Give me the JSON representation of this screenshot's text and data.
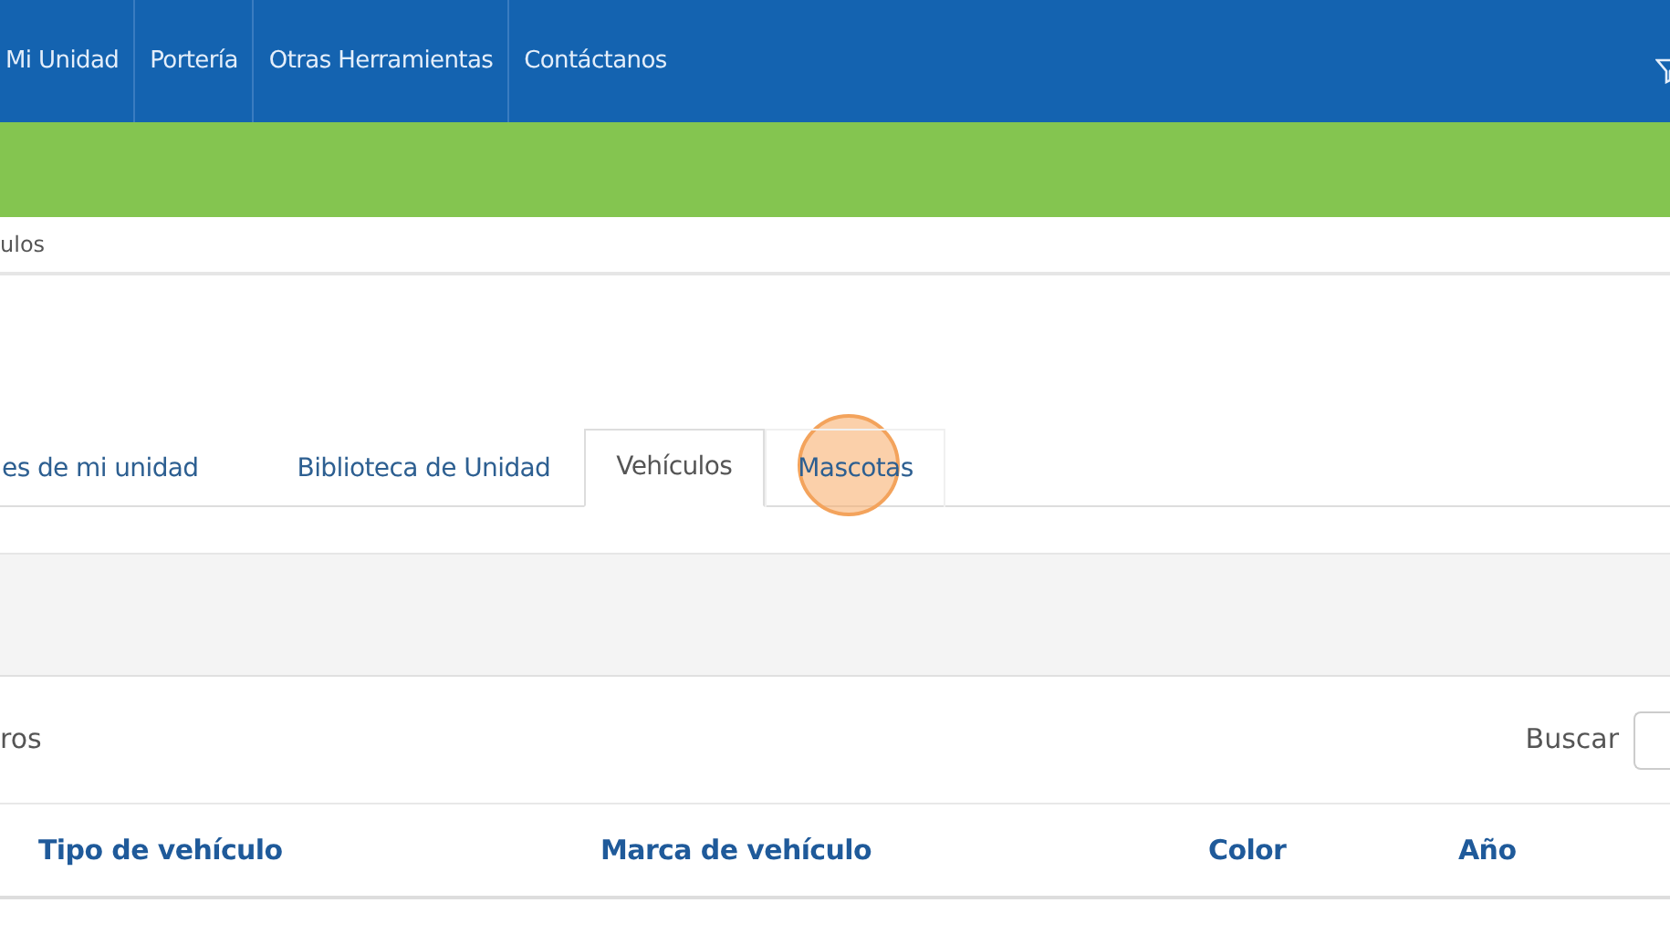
{
  "navbar": {
    "items": [
      {
        "label": "Mi Unidad"
      },
      {
        "label": "Portería"
      },
      {
        "label": "Otras Herramientas"
      },
      {
        "label": "Contáctanos"
      }
    ]
  },
  "breadcrumb": "ulos",
  "tabs": [
    {
      "label": "es de mi unidad",
      "selected": false,
      "clicked": false
    },
    {
      "label": "Biblioteca de Unidad",
      "selected": false,
      "clicked": false
    },
    {
      "label": "Vehículos",
      "selected": true,
      "clicked": false
    },
    {
      "label": "Mascotas",
      "selected": false,
      "clicked": true
    }
  ],
  "table_tools": {
    "length_text": "ros",
    "search_label": "Buscar"
  },
  "table": {
    "columns": [
      "Tipo de vehículo",
      "Marca de vehículo",
      "Color",
      "Año"
    ]
  }
}
